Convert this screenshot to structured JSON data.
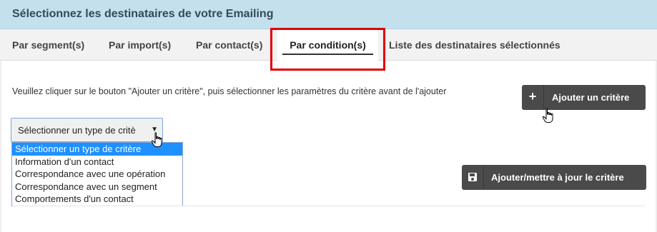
{
  "panel": {
    "title": "Sélectionnez les destinataires de votre Emailing"
  },
  "tabs": [
    {
      "label": "Par segment(s)"
    },
    {
      "label": "Par import(s)"
    },
    {
      "label": "Par contact(s)"
    },
    {
      "label": "Par condition(s)"
    },
    {
      "label": "Liste des destinataires sélectionnés"
    }
  ],
  "active_tab": "Par condition(s)",
  "instruction": "Veuillez cliquer sur le bouton \"Ajouter un critère\", puis sélectionner les paramètres du critère avant de l'ajouter",
  "buttons": {
    "add_criterion": {
      "label": "Ajouter un critère",
      "icon": "plus-icon"
    },
    "save_criterion": {
      "label": "Ajouter/mettre à jour le critère",
      "icon": "floppy-disk-icon"
    }
  },
  "criterion_type_select": {
    "value": "Sélectionner un type de critè",
    "options": [
      "Sélectionner un type de critère",
      "Information d'un contact",
      "Correspondance avec une opération",
      "Correspondance avec un segment",
      "Comportements d'un contact"
    ],
    "highlighted_option": 0
  },
  "colors": {
    "header_bg": "#c4e0ec",
    "title_text": "#34495e",
    "tab_bar_bg": "#f2f2f2",
    "highlight_border": "#e00000",
    "button_bg": "#4a4a4a",
    "option_highlight": "#1e90ff"
  }
}
